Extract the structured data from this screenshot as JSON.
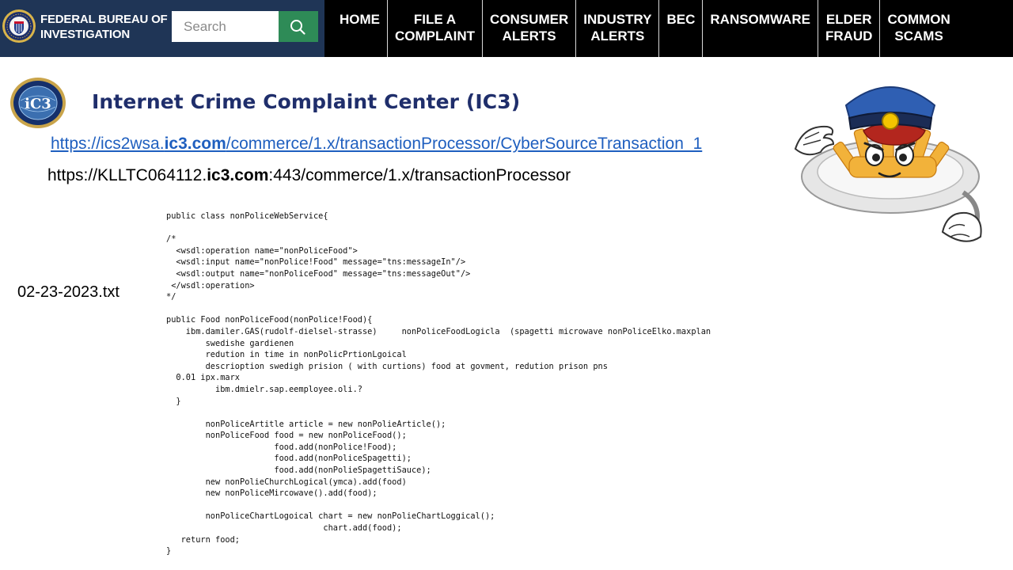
{
  "header": {
    "brand_line1": "FEDERAL BUREAU OF",
    "brand_line2": "INVESTIGATION",
    "search_placeholder": "Search",
    "nav": [
      {
        "label": "HOME"
      },
      {
        "label": "FILE A\nCOMPLAINT"
      },
      {
        "label": "CONSUMER\nALERTS"
      },
      {
        "label": "INDUSTRY\nALERTS"
      },
      {
        "label": "BEC"
      },
      {
        "label": "RANSOMWARE"
      },
      {
        "label": "ELDER\nFRAUD"
      },
      {
        "label": "COMMON\nSCAMS"
      }
    ]
  },
  "content": {
    "title": "Internet Crime Complaint Center (IC3)",
    "link": {
      "prefix": "https://ics2wsa.",
      "bold": "ic3.com",
      "suffix": "/commerce/1.x/transactionProcessor/CyberSourceTransaction_1"
    },
    "url2": {
      "prefix": "https://KLLTC064112.",
      "bold": "ic3.com",
      "suffix": ":443/commerce/1.x/transactionProcessor"
    },
    "filename": "02-23-2023.txt",
    "code": "public class nonPoliceWebService{\n\n/*\n  <wsdl:operation name=\"nonPoliceFood\">\n  <wsdl:input name=\"nonPolice!Food\" message=\"tns:messageIn\"/>\n  <wsdl:output name=\"nonPoliceFood\" message=\"tns:messageOut\"/>\n </wsdl:operation>\n*/\n\npublic Food nonPoliceFood(nonPolice!Food){\n    ibm.damiler.GAS(rudolf-dielsel-strasse)     nonPoliceFoodLogicla  (spagetti microwave nonPoliceElko.maxplan\n        swedishe gardienen\n        redution in time in nonPolicPrtionLgoical\n        descrioption swedigh prision ( with curtions) food at govment, redution prison pns\n  0.01 ipx.marx\n          ibm.dmielr.sap.eemployee.oli.?\n  }\n\n        nonPoliceArtitle article = new nonPolieArticle();\n        nonPoliceFood food = new nonPoliceFood();\n                      food.add(nonPolice!Food);\n                      food.add(nonPoliceSpagetti);\n                      food.add(nonPolieSpagettiSauce);\n        new nonPolieChurchLogical(ymca).add(food)\n        new nonPoliceMircowave().add(food);\n\n        nonPoliceChartLogoical chart = new nonPolieChartLoggical();\n                                chart.add(food);\n   return food;\n}"
  },
  "colors": {
    "brand_bg": "#1f3556",
    "nav_bg": "#000000",
    "search_button": "#2e8b57",
    "title": "#1f2e6b",
    "link": "#1f5fbf"
  },
  "icons": [
    "fbi-seal-icon",
    "search-icon",
    "ic3-logo-icon",
    "police-pasta-mascot"
  ]
}
